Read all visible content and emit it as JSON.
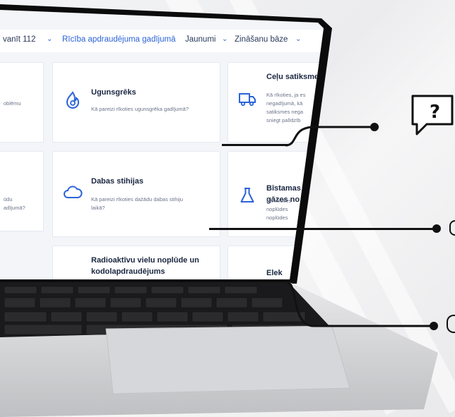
{
  "nav": {
    "item1": "vanīt 112",
    "item2": "Rīcība apdraudējuma gadījumā",
    "item3": "Jaunumi",
    "item4": "Zināšanu bāze"
  },
  "cards": {
    "partial_left_1": "oblēmu",
    "partial_left_2a": "ūdu",
    "partial_left_2b": "adījumā?",
    "fire": {
      "title": "Ugunsgrēks",
      "desc": "Kā pareizi rīkoties ugunsgrēka gadījumā?"
    },
    "nature": {
      "title": "Dabas stihijas",
      "desc1": "Kā pareizi rīkoties dažādu dabas stihiju",
      "desc2": "laikā?"
    },
    "radio": {
      "title1": "Radioaktīvu vielu noplūde un",
      "title2": "kodolapdraudējums"
    },
    "traffic": {
      "title": "Ceļu satiksme",
      "desc1": "Kā rīkoties, ja es",
      "desc2": "negadījumā, kā",
      "desc3": "satiksmes nega",
      "desc4": "sniegt palīdzīb"
    },
    "hazard": {
      "title1": "Bīstamas",
      "title2": "gāzes no",
      "desc1": "Kā rīkoties",
      "desc2": "noplūdes",
      "desc3": "noplūdes"
    },
    "electric": {
      "title": "Elek"
    }
  },
  "icons": {
    "fire": "fire-icon",
    "cloud": "cloud-icon",
    "truck": "truck-icon",
    "flask": "flask-icon",
    "question": "question-bubble-icon"
  },
  "colors": {
    "accent": "#2b63d9",
    "dark": "#111111"
  }
}
